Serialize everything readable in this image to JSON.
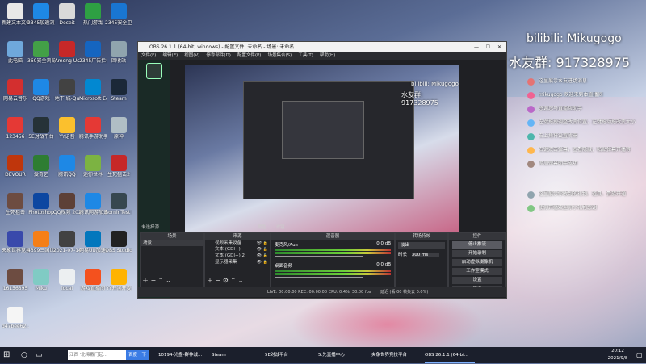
{
  "desktop_icons": [
    {
      "label": "新建文本文档",
      "color": "#e8e8e8"
    },
    {
      "label": "2345加速浏览器",
      "color": "#1e88e5"
    },
    {
      "label": "Deceit",
      "color": "#d9d9d9"
    },
    {
      "label": "热门游戏",
      "color": "#2ea043"
    },
    {
      "label": "2345安全卫士",
      "color": "#1976d2"
    },
    {
      "label": "此电脑",
      "color": "#6fa8dc"
    },
    {
      "label": "360安全浏览器",
      "color": "#43a047"
    },
    {
      "label": "Among Us",
      "color": "#c62828"
    },
    {
      "label": "2345广告拦截",
      "color": "#1565c0"
    },
    {
      "label": "回收站",
      "color": "#90a4ae"
    },
    {
      "label": "网易云音乐",
      "color": "#d32f2f"
    },
    {
      "label": "QQ游戏",
      "color": "#1e88e5"
    },
    {
      "label": "地下 城-Qu",
      "color": "#424242"
    },
    {
      "label": "Microsoft Edge",
      "color": "#0288d1"
    },
    {
      "label": "Steam",
      "color": "#1b2838"
    },
    {
      "label": "123456",
      "color": "#e53935"
    },
    {
      "label": "5E对战平台",
      "color": "#263238"
    },
    {
      "label": "YY语音",
      "color": "#fbc02d"
    },
    {
      "label": "腾讯手游助手",
      "color": "#e53935"
    },
    {
      "label": "原神",
      "color": "#b0bec5"
    },
    {
      "label": "DEVOUR",
      "color": "#bf360c"
    },
    {
      "label": "爱奇艺",
      "color": "#2e7d32"
    },
    {
      "label": "腾讯QQ",
      "color": "#1e88e5"
    },
    {
      "label": "迷你世界",
      "color": "#7cb342"
    },
    {
      "label": "生死狙击2",
      "color": "#c62828"
    },
    {
      "label": "生死狙击",
      "color": "#6d4c41"
    },
    {
      "label": "Photoshop",
      "color": "#0d47a1"
    },
    {
      "label": "QQ视频 20210116",
      "color": "#5d4037"
    },
    {
      "label": "腾讯网游加速器",
      "color": "#1e88e5"
    },
    {
      "label": "BorninTest 压力测试",
      "color": "#37474f"
    },
    {
      "label": "夹象世界竞技平台",
      "color": "#3949ab"
    },
    {
      "label": "4399三国世界",
      "color": "#f57f17"
    },
    {
      "label": "2021-07-14 19-32-02",
      "color": "#424242"
    },
    {
      "label": "网易UU加速器",
      "color": "#0277bd"
    },
    {
      "label": "OBS Studio",
      "color": "#212121"
    },
    {
      "label": "16156395",
      "color": "#6d4c41"
    },
    {
      "label": "Miku",
      "color": "#80cbc4"
    },
    {
      "label": "local",
      "color": "#eceff1"
    },
    {
      "label": "游戏直播间",
      "color": "#f4511e"
    },
    {
      "label": "YY开黑开麦",
      "color": "#ffb300"
    },
    {
      "label": "d47bee62...",
      "color": "#f5f5f5"
    }
  ],
  "overlay": {
    "bilibili": "bilibili: Mikugogo",
    "fan_group": "水友群: 917328975"
  },
  "live_panel": {
    "chat": [
      "这里展示水友进场消息",
      "mikugogo 欢迎来到本直播间",
      "感谢您与直播帮助手",
      "左键拖拽调整改变位置，左键拖动拖改变大小",
      "右上角将设置所需",
      "右键双击弹幕，查看隐藏，粘贴弹幕开播等",
      "添加弹幕助手成功",
      "这里展示你收到的礼物、道具、贵族开通",
      "使你开播欢迎你小礼物感谢"
    ]
  },
  "obs": {
    "title": "OBS 26.1.1 (64-bit, windows) - 配置文件: 未命名 - 场景: 未命名",
    "menu": [
      "文件(F)",
      "编辑(E)",
      "视图(V)",
      "停靠部件(D)",
      "配置文件(P)",
      "场景集合(S)",
      "工具(T)",
      "帮助(H)"
    ],
    "scene_label": "未选择源",
    "props_btn": "属性",
    "filter_btn": "滤镜",
    "docks": {
      "scenes": "场景",
      "sources": "来源",
      "mixer": "混音器",
      "transitions": "转场特效",
      "controls": "控件"
    },
    "scene_items": [
      "场景"
    ],
    "sources": [
      "视频采集设备",
      "文本 (GDI+)",
      "文本 (GDI+) 2",
      "显示器采集"
    ],
    "mixer": [
      {
        "name": "麦克风/Aux",
        "db": "0.0 dB"
      },
      {
        "name": "桌面音频",
        "db": "0.0 dB"
      }
    ],
    "transition": {
      "type": "淡出",
      "duration_label": "时长",
      "duration": "300 ms"
    },
    "controls": [
      "停止推流",
      "开始录制",
      "启动虚拟摄像机",
      "工作室模式",
      "设置",
      "退出"
    ],
    "status": "LIVE: 00:00:00   REC: 00:00:00   CPU: 0.4%, 30.00 fps",
    "status_right": "延迟 (丢 00 帧失去 0.0%)"
  },
  "taskbar": {
    "search_placeholder": "江西 '北稀戴门起...",
    "search_button": "百度一下",
    "items": [
      {
        "label": "10194-光盘-群神战..."
      },
      {
        "label": "Steam"
      },
      {
        "label": "5E对战平台"
      },
      {
        "label": "5.先直播中心"
      },
      {
        "label": "夹象世界竞技平台"
      },
      {
        "label": "OBS 26.1.1 (64-bi..."
      }
    ],
    "time": "20:12",
    "date": "2021/9/8"
  }
}
